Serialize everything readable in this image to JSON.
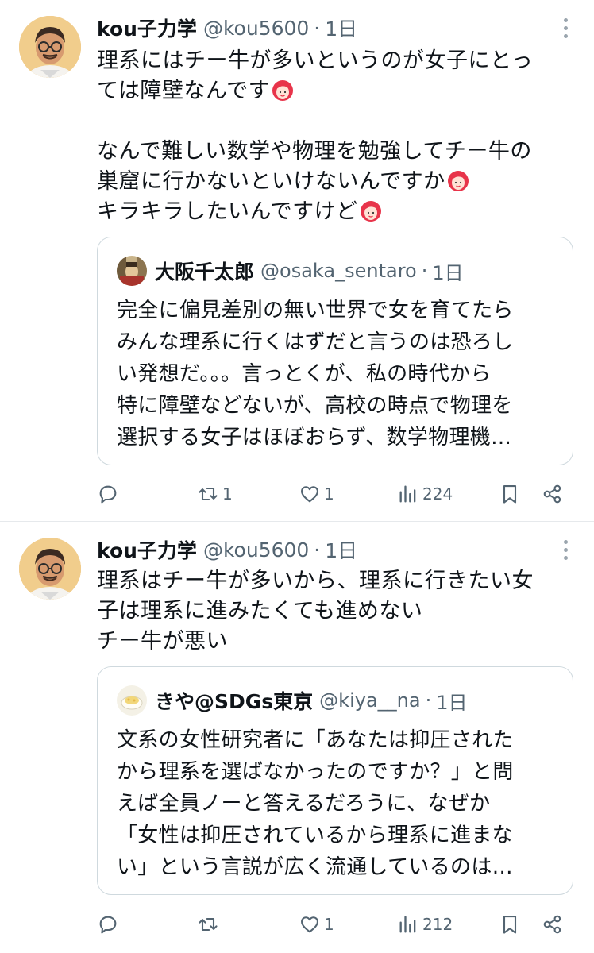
{
  "tweets": [
    {
      "display_name": "kou子力学",
      "handle": "@kou5600",
      "separator": "·",
      "time": "1日",
      "text_lines": [
        "理系にはチー牛が多いというのが女子にとっ",
        "ては障壁なんです",
        "",
        "なんで難しい数学や物理を勉強してチー牛の",
        "巣窟に行かないといけないんですか",
        "キラキラしたいんですけど"
      ],
      "emoji_icon": "woman-face-emoji",
      "quote": {
        "display_name": "大阪千太郎",
        "handle": "@osaka_sentaro",
        "separator": "·",
        "time": "1日",
        "text_lines": [
          "完全に偏見差別の無い世界で女を育てたら",
          "みんな理系に行くはずだと言うのは恐ろし",
          "い発想だ。。。言っとくが、私の時代から",
          "特に障壁などないが、高校の時点で物理を",
          "選択する女子はほぼおらず、数学物理機…"
        ]
      },
      "actions": {
        "reply_count": "",
        "retweet_count": "1",
        "like_count": "1",
        "views_count": "224"
      }
    },
    {
      "display_name": "kou子力学",
      "handle": "@kou5600",
      "separator": "·",
      "time": "1日",
      "text_lines": [
        "理系はチー牛が多いから、理系に行きたい女",
        "子は理系に進みたくても進めない",
        "チー牛が悪い"
      ],
      "quote": {
        "display_name": "きや@SDGs東京",
        "handle": "@kiya__na",
        "separator": "·",
        "time": "1日",
        "text_lines": [
          "文系の女性研究者に「あなたは抑圧された",
          "から理系を選ばなかったのですか？」と問",
          "えば全員ノーと答えるだろうに、なぜか",
          "「女性は抑圧されているから理系に進まな",
          "い」という言説が広く流通しているのは…"
        ]
      },
      "actions": {
        "reply_count": "",
        "retweet_count": "",
        "like_count": "1",
        "views_count": "212"
      }
    }
  ],
  "colors": {
    "text": "#0f1419",
    "secondary": "#536471",
    "border": "#cfd9de",
    "emoji_red": "#e8344a"
  },
  "icons": [
    "reply-icon",
    "retweet-icon",
    "like-icon",
    "views-icon",
    "bookmark-icon",
    "share-icon",
    "more-icon"
  ]
}
